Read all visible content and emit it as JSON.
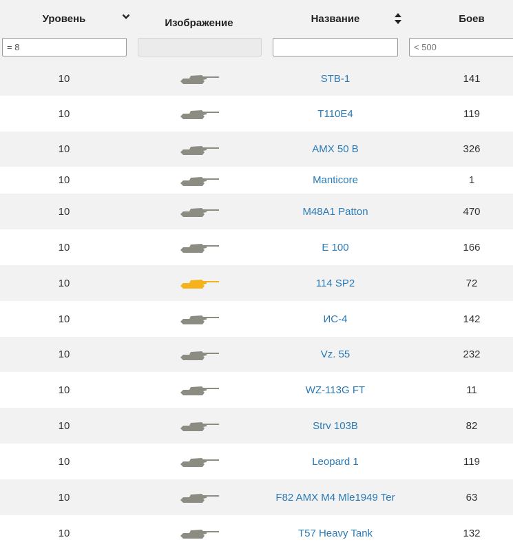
{
  "columns": [
    {
      "key": "level",
      "title": "Уровень",
      "sort_icon": "chevron-down-icon"
    },
    {
      "key": "image",
      "title": "Изображение"
    },
    {
      "key": "name",
      "title": "Название",
      "sort_icon": "sort-updown-icon"
    },
    {
      "key": "battles",
      "title": "Боев"
    }
  ],
  "filters": {
    "level": "= 8",
    "image": "",
    "name": "",
    "battles_placeholder": "< 500"
  },
  "colors": {
    "tank_default": "#8c8c82",
    "tank_highlight": "#f5b21b",
    "link": "#2a7ab5",
    "stripe": "#f2f2f2"
  },
  "rows": [
    {
      "level": "10",
      "name": "STB-1",
      "battles": "141",
      "icon": "tank-icon"
    },
    {
      "level": "10",
      "name": "T110E4",
      "battles": "119",
      "icon": "tank-icon"
    },
    {
      "level": "10",
      "name": "AMX 50 B",
      "battles": "326",
      "icon": "tank-icon"
    },
    {
      "level": "10",
      "name": "Manticore",
      "battles": "1",
      "icon": "tank-icon"
    },
    {
      "level": "10",
      "name": "M48A1 Patton",
      "battles": "470",
      "icon": "tank-icon"
    },
    {
      "level": "10",
      "name": "E 100",
      "battles": "166",
      "icon": "tank-icon"
    },
    {
      "level": "10",
      "name": "114 SP2",
      "battles": "72",
      "icon": "tank-icon",
      "highlight": true
    },
    {
      "level": "10",
      "name": "ИС-4",
      "battles": "142",
      "icon": "tank-icon"
    },
    {
      "level": "10",
      "name": "Vz. 55",
      "battles": "232",
      "icon": "tank-icon"
    },
    {
      "level": "10",
      "name": "WZ-113G FT",
      "battles": "11",
      "icon": "tank-icon"
    },
    {
      "level": "10",
      "name": "Strv 103B",
      "battles": "82",
      "icon": "tank-icon"
    },
    {
      "level": "10",
      "name": "Leopard 1",
      "battles": "119",
      "icon": "tank-icon"
    },
    {
      "level": "10",
      "name": "F82 AMX M4 Mle1949 Ter",
      "battles": "63",
      "icon": "tank-icon"
    },
    {
      "level": "10",
      "name": "T57 Heavy Tank",
      "battles": "132",
      "icon": "tank-icon"
    }
  ]
}
